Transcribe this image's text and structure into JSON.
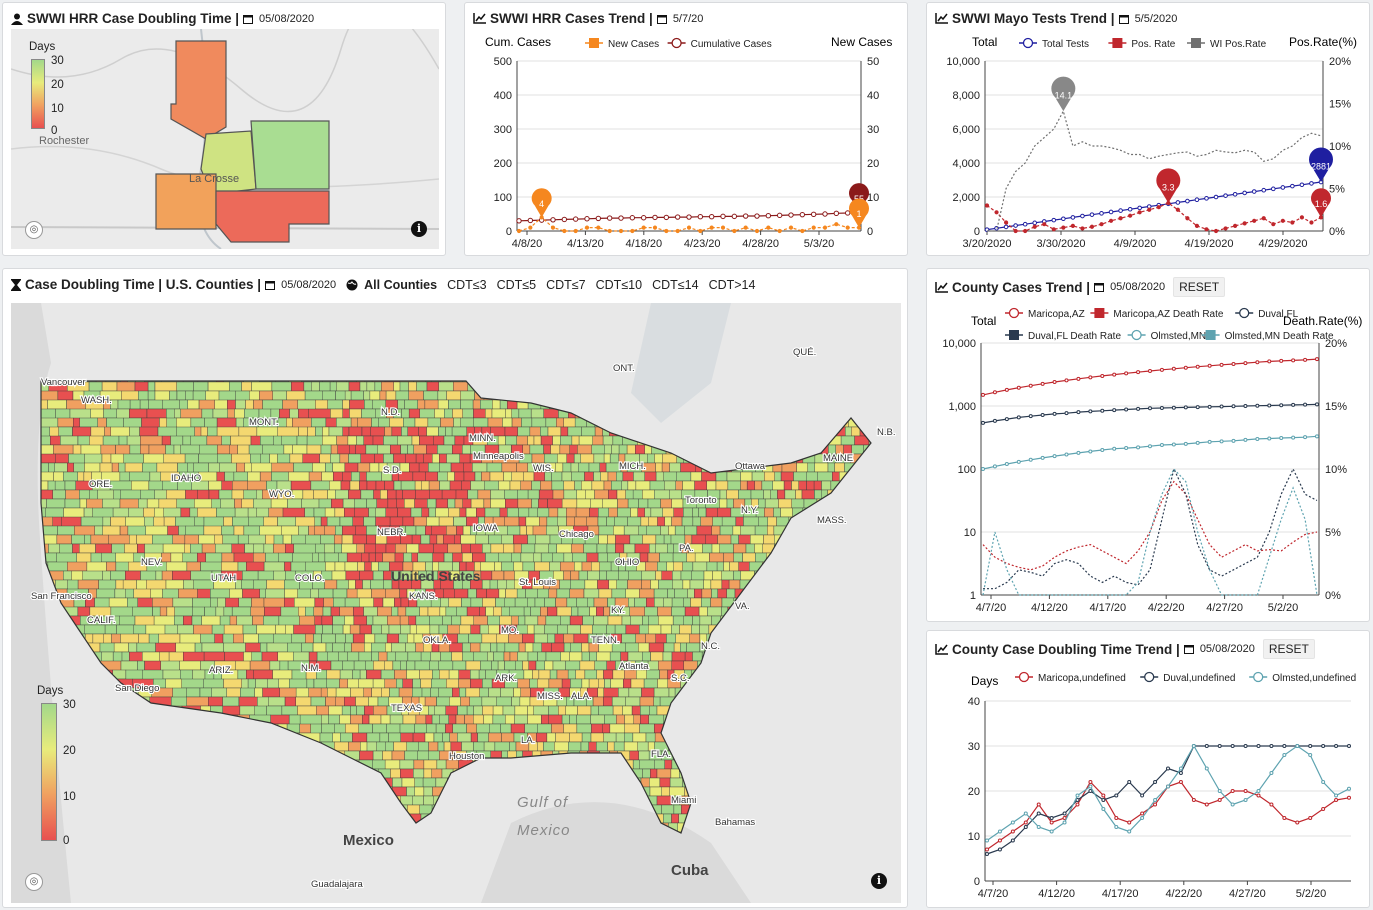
{
  "panel_hrr_map": {
    "title": "SWWI HRR Case Doubling Time |",
    "date": "05/08/2020",
    "legend_title": "Days",
    "legend_ticks": [
      "30",
      "20",
      "10",
      "0"
    ],
    "city_labels": [
      "Rochester",
      "La Crosse"
    ]
  },
  "panel_hrr_trend": {
    "title": "SWWI HRR Cases Trend |",
    "date": "5/7/20",
    "left_axis": "Cum. Cases",
    "right_axis": "New Cases",
    "series_names": [
      "New Cases",
      "Cumulative Cases"
    ],
    "callouts": [
      "4",
      "55",
      "1"
    ]
  },
  "panel_mayo": {
    "title": "SWWI Mayo Tests Trend |",
    "date": "5/5/2020",
    "left_axis": "Total",
    "right_axis": "Pos.Rate(%)",
    "series_names": [
      "Total Tests",
      "Pos. Rate",
      "WI Pos.Rate"
    ],
    "callouts": [
      "14.1",
      "3.3",
      "2881",
      "1.6"
    ]
  },
  "panel_us_map": {
    "title": "Case Doubling Time | U.S. Counties |",
    "date": "05/08/2020",
    "filter_all": "All Counties",
    "filters": [
      "CDT≤3",
      "CDT≤5",
      "CDT≤7",
      "CDT≤10",
      "CDT≤14",
      "CDT>14"
    ],
    "legend_title": "Days",
    "legend_ticks": [
      "30",
      "20",
      "10",
      "0"
    ],
    "place_labels": [
      "Vancouver",
      "WASH.",
      "MONT.",
      "N.D.",
      "MINN.",
      "ONT.",
      "QUÉ.",
      "N.B.",
      "ORE.",
      "IDAHO",
      "WYO.",
      "S.D.",
      "Minneapolis",
      "WIS.",
      "MICH.",
      "Ottawa",
      "MAINE",
      "Toronto",
      "N.Y.",
      "MASS.",
      "NEV.",
      "UTAH",
      "COLO.",
      "NEBR.",
      "IOWA",
      "Chicago",
      "OHIO",
      "PA.",
      "United States",
      "San Francisco",
      "CALIF.",
      "St. Louis",
      "VA.",
      "KANS.",
      "MO.",
      "KY.",
      "San Diego",
      "ARIZ.",
      "N.M.",
      "OKLA.",
      "TENN.",
      "N.C.",
      "ARK.",
      "S.C.",
      "MISS.",
      "ALA.",
      "Atlanta",
      "TEXAS",
      "LA.",
      "Houston",
      "FLA.",
      "Miami",
      "Gulf of",
      "Mexico",
      "Bahamas",
      "Mexico",
      "Guadalajara",
      "Cuba"
    ]
  },
  "panel_county_cases": {
    "title": "County Cases Trend |",
    "date": "05/08/2020",
    "reset": "RESET",
    "left_axis": "Total",
    "right_axis": "Death.Rate(%)",
    "series_names": [
      "Maricopa,AZ",
      "Maricopa,AZ Death Rate",
      "Duval,FL",
      "Duval,FL Death Rate",
      "Olmsted,MN",
      "Olmsted,MN Death Rate"
    ]
  },
  "panel_county_cdt": {
    "title": "County Case Doubling Time Trend |",
    "date": "05/08/2020",
    "reset": "RESET",
    "left_axis": "Days",
    "series_names": [
      "Maricopa,undefined",
      "Duval,undefined",
      "Olmsted,undefined"
    ]
  },
  "colors": {
    "orange": "#f5871f",
    "darkred": "#8b1a1a",
    "navy": "#1f1fa0",
    "red": "#c0272d",
    "gray": "#707070",
    "dark": "#2a3a4f",
    "teal": "#5ea3b0",
    "map_green": "#a3d88a",
    "map_yellow": "#e8ec7c",
    "map_orange": "#f0a060",
    "map_red": "#e85050"
  },
  "icons": {
    "user": "user-icon",
    "calendar": "calendar-icon",
    "chart": "line-chart-icon",
    "hourglass": "hourglass-icon",
    "globe": "globe-icon",
    "info": "info-icon",
    "locate": "locate-icon"
  },
  "chart_data": [
    {
      "type": "line",
      "title": "SWWI HRR Cases Trend",
      "x": [
        "4/8/20",
        "4/13/20",
        "4/18/20",
        "4/23/20",
        "4/28/20",
        "5/3/20"
      ],
      "ylim_left": [
        0,
        500
      ],
      "ylim_right": [
        0,
        50
      ],
      "y_ticks_left": [
        "500",
        "400",
        "300",
        "200",
        "100",
        "0"
      ],
      "y_ticks_right": [
        "50",
        "40",
        "30",
        "20",
        "10",
        "0"
      ],
      "series": [
        {
          "name": "Cumulative Cases",
          "axis": "left",
          "values": [
            30,
            31,
            32,
            33,
            34,
            35,
            36,
            37,
            38,
            38,
            39,
            39,
            40,
            40,
            41,
            41,
            42,
            42,
            43,
            43,
            44,
            44,
            45,
            46,
            47,
            48,
            49,
            50,
            52,
            53,
            55
          ]
        },
        {
          "name": "New Cases",
          "axis": "right",
          "values": [
            0,
            1,
            4,
            1,
            0,
            0,
            1,
            1,
            0,
            0,
            0,
            1,
            1,
            0,
            0,
            1,
            0,
            1,
            1,
            0,
            1,
            0,
            1,
            0,
            1,
            0,
            1,
            1,
            2,
            1,
            1
          ]
        }
      ]
    },
    {
      "type": "line",
      "title": "SWWI Mayo Tests Trend",
      "x": [
        "3/20/2020",
        "3/30/2020",
        "4/9/2020",
        "4/19/2020",
        "4/29/2020"
      ],
      "ylim_left": [
        0,
        10000
      ],
      "ylim_right": [
        0,
        20
      ],
      "y_ticks_left": [
        "10,000",
        "8,000",
        "6,000",
        "4,000",
        "2,000",
        "0"
      ],
      "y_ticks_right": [
        "20%",
        "15%",
        "10%",
        "5%",
        "0%"
      ],
      "series": [
        {
          "name": "Total Tests",
          "axis": "left",
          "values": [
            80,
            160,
            240,
            320,
            400,
            480,
            560,
            640,
            720,
            800,
            880,
            960,
            1040,
            1120,
            1200,
            1280,
            1360,
            1440,
            1520,
            1600,
            1680,
            1760,
            1840,
            1920,
            2000,
            2080,
            2160,
            2240,
            2320,
            2400,
            2480,
            2560,
            2640,
            2720,
            2800,
            2881
          ]
        },
        {
          "name": "Pos. Rate",
          "axis": "right",
          "values": [
            3,
            2.2,
            1,
            0,
            0,
            0.5,
            0.8,
            0.2,
            0.4,
            0.6,
            0.3,
            0.5,
            0.8,
            1.2,
            1.5,
            1.8,
            2.2,
            2.5,
            2.8,
            3.3,
            2.5,
            1.5,
            0.6,
            0.2,
            0,
            0.3,
            0.6,
            0.9,
            1.2,
            1.5,
            0.8,
            1.2,
            1.0,
            1.6,
            1.0,
            1.6
          ]
        },
        {
          "name": "WI Pos.Rate",
          "axis": "right",
          "values": [
            0,
            0,
            5,
            7,
            8,
            10,
            11,
            12,
            14.1,
            10,
            10.5,
            10,
            10,
            9.8,
            9.5,
            9,
            9,
            8.5,
            8.8,
            9,
            9.2,
            9.3,
            8.8,
            9,
            9.5,
            9.3,
            9.2,
            9.5,
            9.3,
            8.2,
            8.5,
            9.5,
            10,
            11,
            11.5,
            11.2
          ]
        }
      ]
    },
    {
      "type": "line",
      "title": "County Cases Trend",
      "x": [
        "4/7/20",
        "4/12/20",
        "4/17/20",
        "4/22/20",
        "4/27/20",
        "5/2/20"
      ],
      "ylog": true,
      "ylim_left": [
        1,
        10000
      ],
      "ylim_right": [
        0,
        20
      ],
      "y_ticks_left": [
        "10,000",
        "1,000",
        "100",
        "10",
        "1"
      ],
      "y_ticks_right": [
        "20%",
        "15%",
        "10%",
        "5%",
        "0%"
      ],
      "series": [
        {
          "name": "Maricopa,AZ",
          "axis": "left",
          "values": [
            1500,
            1650,
            1800,
            1950,
            2100,
            2250,
            2400,
            2550,
            2700,
            2850,
            3000,
            3150,
            3300,
            3450,
            3600,
            3750,
            3900,
            4050,
            4200,
            4350,
            4500,
            4650,
            4800,
            4950,
            5100,
            5200,
            5300,
            5400,
            5550
          ]
        },
        {
          "name": "Maricopa,AZ Death Rate",
          "axis": "right",
          "values": [
            4,
            3,
            2.5,
            2.2,
            2,
            2.3,
            3,
            3.5,
            3.8,
            4,
            3.5,
            3,
            2.5,
            3.5,
            5,
            7.5,
            9,
            8,
            6,
            4,
            3,
            3.5,
            4,
            3.5,
            3.6,
            3.5,
            4.2,
            4.8,
            5
          ]
        },
        {
          "name": "Duval,FL",
          "axis": "left",
          "values": [
            540,
            580,
            620,
            660,
            690,
            720,
            750,
            770,
            800,
            820,
            840,
            860,
            880,
            900,
            920,
            930,
            940,
            950,
            960,
            970,
            980,
            990,
            1000,
            1010,
            1020,
            1030,
            1040,
            1050,
            1060
          ]
        },
        {
          "name": "Duval,FL Death Rate",
          "axis": "right",
          "values": [
            0.5,
            0.5,
            1,
            2,
            1.8,
            1.5,
            2.5,
            2.8,
            2.5,
            1.5,
            1,
            1.5,
            1,
            0.8,
            2,
            6,
            10,
            8,
            4,
            2,
            1.5,
            2,
            2.5,
            3,
            5,
            8,
            10,
            8,
            7.5
          ]
        },
        {
          "name": "Olmsted,MN",
          "axis": "left",
          "values": [
            100,
            110,
            120,
            130,
            140,
            150,
            160,
            170,
            180,
            190,
            200,
            210,
            215,
            220,
            230,
            240,
            245,
            250,
            260,
            270,
            275,
            280,
            290,
            300,
            305,
            310,
            315,
            320,
            330
          ]
        },
        {
          "name": "Olmsted,MN Death Rate",
          "axis": "right",
          "values": [
            0,
            5,
            2,
            0,
            0,
            0,
            0,
            0,
            0,
            0,
            0,
            0,
            0,
            1,
            5,
            8,
            10,
            9,
            5,
            2,
            0,
            0,
            0,
            0,
            3,
            6,
            8.5,
            6,
            0
          ]
        }
      ]
    },
    {
      "type": "line",
      "title": "County Case Doubling Time Trend",
      "x": [
        "4/7/20",
        "4/12/20",
        "4/17/20",
        "4/22/20",
        "4/27/20",
        "5/2/20"
      ],
      "ylim": [
        0,
        40
      ],
      "y_ticks": [
        "40",
        "30",
        "20",
        "10",
        "0"
      ],
      "series": [
        {
          "name": "Maricopa,undefined",
          "values": [
            7,
            9,
            11,
            13,
            17,
            13,
            14,
            17,
            22,
            19,
            14,
            13,
            15,
            17,
            21,
            22,
            18,
            17,
            18,
            20,
            20,
            19,
            17,
            14,
            13,
            14,
            16,
            18,
            18.5
          ]
        },
        {
          "name": "Duval,undefined",
          "values": [
            6,
            7,
            9,
            12,
            15,
            14,
            15,
            18,
            20,
            18,
            19,
            22,
            19,
            22,
            25,
            24,
            30,
            30,
            30,
            30,
            30,
            30,
            30,
            30,
            30,
            30,
            30,
            30,
            30
          ]
        },
        {
          "name": "Olmsted,undefined",
          "values": [
            9,
            11,
            13,
            15,
            12,
            11,
            13,
            19,
            21,
            16,
            12,
            11,
            14,
            18,
            21,
            25,
            30,
            25,
            20,
            17,
            18,
            20,
            24,
            28,
            30,
            28,
            22,
            19,
            20.5
          ]
        }
      ]
    }
  ]
}
